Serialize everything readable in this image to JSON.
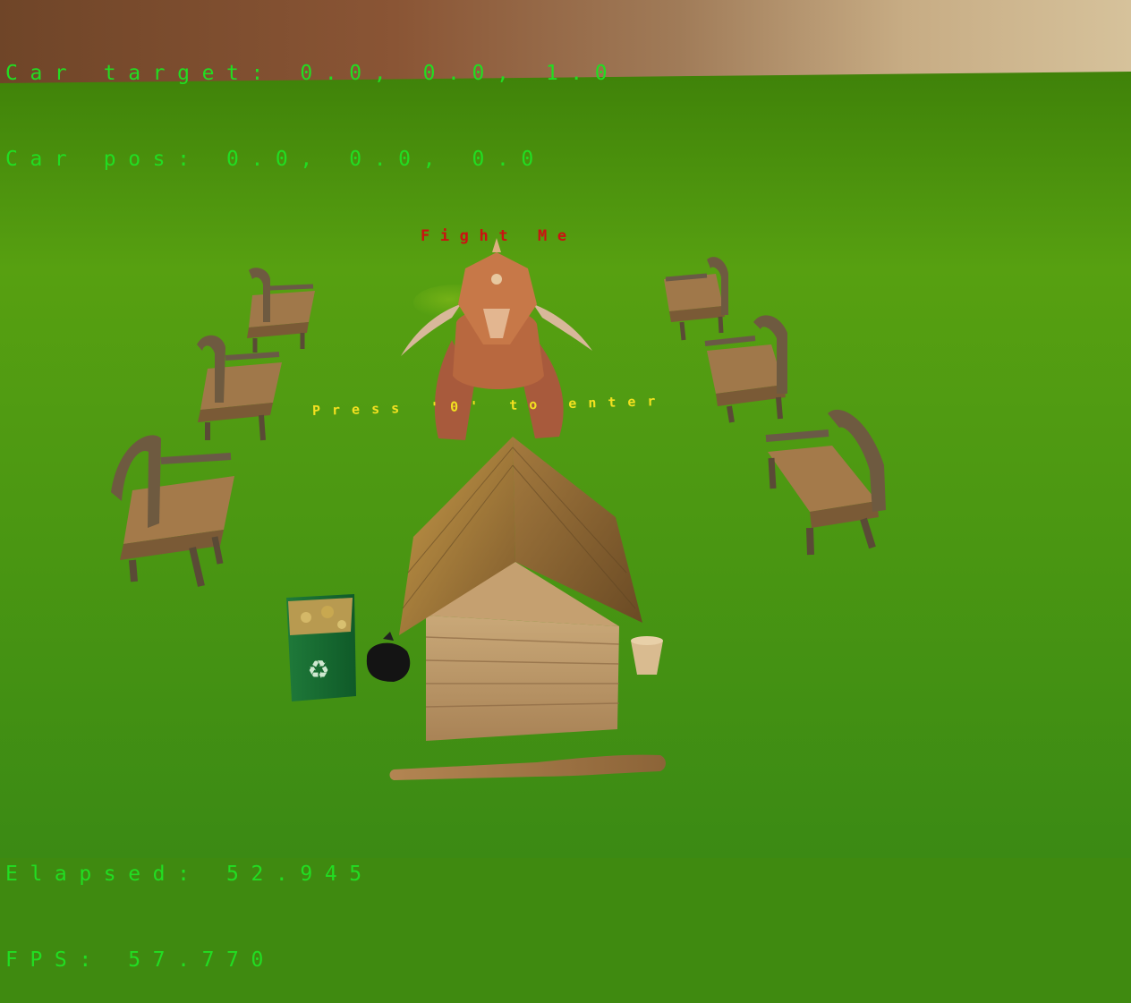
{
  "hud": {
    "car_target": "Car target: 0.0, 0.0, 1.0",
    "car_pos": "Car pos: 0.0, 0.0, 0.0",
    "elapsed": "Elapsed: 52.945",
    "fps": "FPS: 57.770"
  },
  "world_labels": {
    "enemy": "Fight Me",
    "house": "Press '0' to enter"
  },
  "colors": {
    "hud_text": "#22dd22",
    "enemy_label": "#cc1111",
    "house_label": "#f2e020",
    "ground": "#4f9a12",
    "sky": "#8a5a3a"
  },
  "icons": {
    "recycle": "recycle-icon"
  }
}
